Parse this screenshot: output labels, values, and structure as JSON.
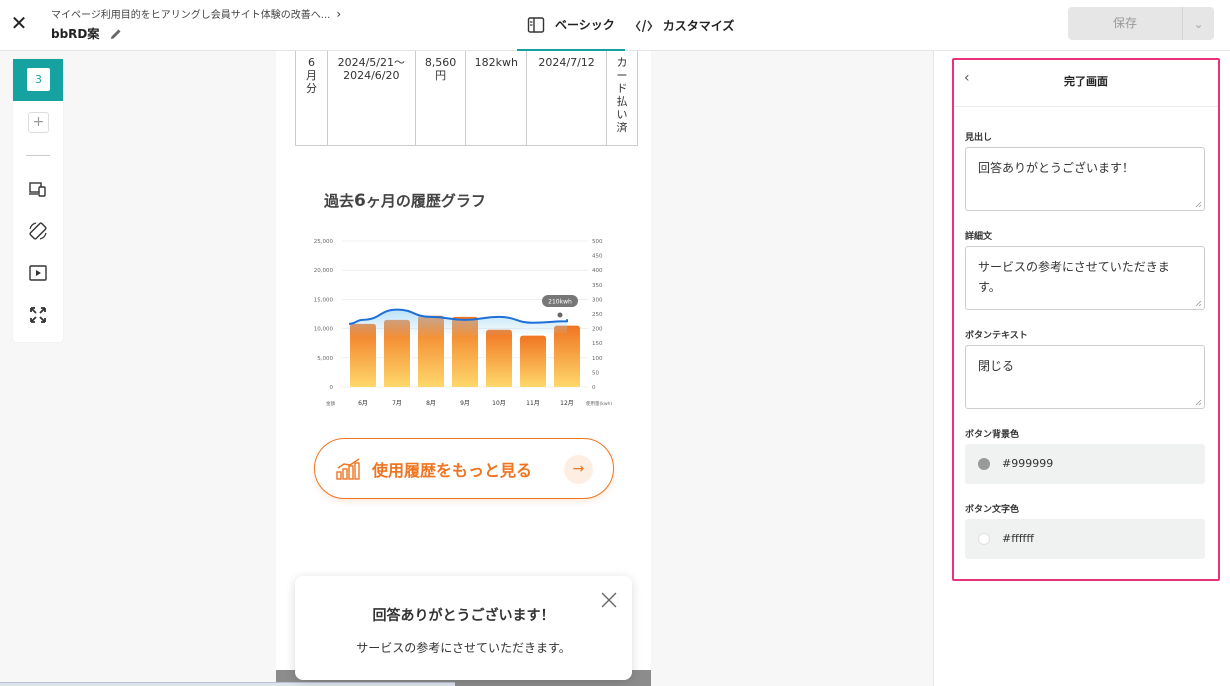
{
  "header": {
    "close_icon": "close-icon",
    "breadcrumb": "マイページ利用目的をヒアリングし会員サイト体験の改善へ...",
    "project_name": "bbRD案",
    "tabs": [
      {
        "label": "ベーシック",
        "icon": "layout-icon"
      },
      {
        "label": "カスタマイズ",
        "icon": "code-icon"
      }
    ],
    "save_label": "保存"
  },
  "left_toolbar": {
    "step_number": "3",
    "add_label": "+"
  },
  "preview": {
    "table_row": {
      "month": "6月分",
      "period_start": "2024/5/21〜",
      "period_end": "2024/6/20",
      "amount_num": "8,560",
      "amount_unit": "円",
      "usage": "182kwh",
      "date": "2024/7/12",
      "status": "カード払い済"
    },
    "chart_title_pre": "過去",
    "chart_title_num": "6",
    "chart_title_post": "ヶ月の履歴グラフ",
    "cta_label": "使用履歴をもっと見る",
    "toast_heading": "回答ありがとうございます！",
    "toast_body": "サービスの参考にさせていただきます。"
  },
  "chart_data": {
    "type": "bar",
    "categories": [
      "6月",
      "7月",
      "8月",
      "9月",
      "10月",
      "11月",
      "12月"
    ],
    "series": [
      {
        "name": "金額",
        "values": [
          10800,
          11500,
          12200,
          12000,
          9800,
          8800,
          10500
        ]
      },
      {
        "name": "使用量(kwh)",
        "values": [
          230,
          265,
          240,
          230,
          240,
          220,
          225
        ]
      }
    ],
    "left_ticks": [
      "25,000",
      "20,000",
      "15,000",
      "10,000",
      "5,000",
      "0"
    ],
    "right_ticks": [
      "500",
      "450",
      "400",
      "350",
      "300",
      "250",
      "200",
      "150",
      "100",
      "50",
      "0"
    ],
    "left_label": "金額",
    "right_label": "使用量(kwh)",
    "tooltip": "210kwh",
    "ylim_left": [
      0,
      25000
    ],
    "ylim_right": [
      0,
      500
    ],
    "grid": true,
    "colors": {
      "bar_top": "#f07522",
      "bar_bottom": "#ffd86b",
      "line": "#1e6fd9"
    }
  },
  "right_panel": {
    "title": "完了画面",
    "fields": [
      {
        "label": "見出し",
        "value": "回答ありがとうございます！"
      },
      {
        "label": "詳細文",
        "value": "サービスの参考にさせていただきます。"
      },
      {
        "label": "ボタンテキスト",
        "value": "閉じる"
      }
    ],
    "colors": [
      {
        "label": "ボタン背景色",
        "value": "#999999"
      },
      {
        "label": "ボタン文字色",
        "value": "#ffffff"
      }
    ]
  },
  "theme": {
    "accent": "#17a2a2",
    "highlight": "#e8337a",
    "cta": "#f07522"
  }
}
